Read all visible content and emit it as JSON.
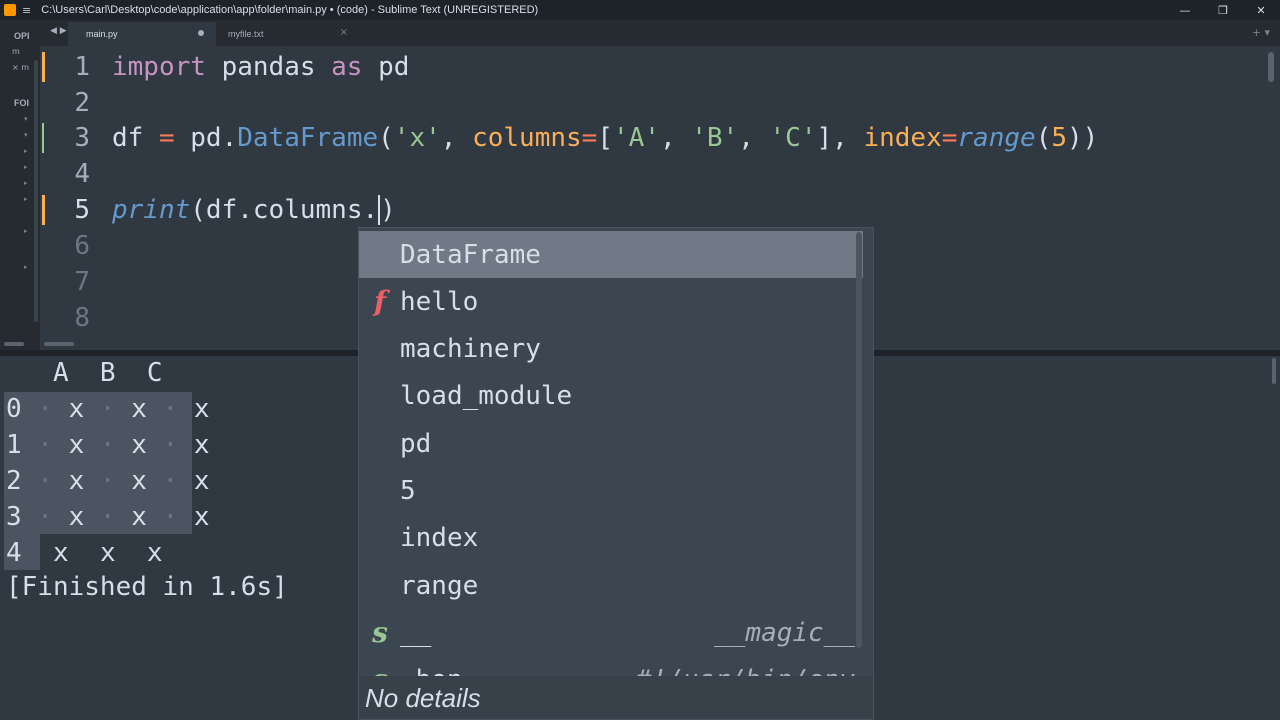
{
  "window": {
    "title": "C:\\Users\\Carl\\Desktop\\code\\application\\app\\folder\\main.py • (code) - Sublime Text (UNREGISTERED)",
    "minimize_glyph": "—",
    "maximize_glyph": "❐",
    "close_glyph": "✕",
    "menu_glyph": "≡"
  },
  "sidebar": {
    "open_files_label": "OPI",
    "folders_label": "FOI",
    "rows": [
      "m",
      "× m"
    ],
    "tree_glyphs": [
      "▾",
      "▾",
      "▸",
      "▸",
      "▸",
      "▸",
      "▸",
      "▸"
    ]
  },
  "tabs": {
    "nav": "◀ ▶",
    "items": [
      {
        "label": "main.py",
        "active": true,
        "dirty": true
      },
      {
        "label": "myfile.txt",
        "active": false,
        "close": "×"
      }
    ],
    "right_controls": "+ ▾"
  },
  "editor": {
    "lines": [
      {
        "number": "1",
        "modified": true
      },
      {
        "number": "2"
      },
      {
        "number": "3",
        "modified": true
      },
      {
        "number": "4"
      },
      {
        "number": "5",
        "modified": true,
        "current": true
      },
      {
        "number": "6"
      },
      {
        "number": "7"
      },
      {
        "number": "8"
      }
    ],
    "code": {
      "l1_import": "import",
      "l1_pandas": " pandas ",
      "l1_as": "as",
      "l1_pd": " pd",
      "l3_df": "df ",
      "l3_eq": "=",
      "l3_pd": " pd.",
      "l3_DataFrame": "DataFrame",
      "l3_open": "(",
      "l3_x": "'x'",
      "l3_comma1": ", ",
      "l3_columns": "columns",
      "l3_eq2": "=",
      "l3_bracket_open": "[",
      "l3_A": "'A'",
      "l3_comma2": ", ",
      "l3_B": "'B'",
      "l3_comma3": ", ",
      "l3_C": "'C'",
      "l3_bracket_close": "], ",
      "l3_index": "index",
      "l3_eq3": "=",
      "l3_range": "range",
      "l3_paren": "(",
      "l3_five": "5",
      "l3_close": "))",
      "l5_print": "print",
      "l5_rest": "(df.columns.",
      "l5_cursor_char": ")"
    }
  },
  "output": {
    "header": "   A  B  C",
    "rows": [
      {
        "index": "0",
        "cells": [
          "x",
          "x",
          "x"
        ]
      },
      {
        "index": "1",
        "cells": [
          "x",
          "x",
          "x"
        ]
      },
      {
        "index": "2",
        "cells": [
          "x",
          "x",
          "x"
        ]
      },
      {
        "index": "3",
        "cells": [
          "x",
          "x",
          "x"
        ]
      },
      {
        "index": "4",
        "cells": [
          "x",
          "x",
          "x"
        ]
      }
    ],
    "finished": "[Finished in 1.6s]"
  },
  "autocomplete": {
    "items": [
      {
        "kind": "",
        "label": "DataFrame",
        "annotation": "",
        "selected": true
      },
      {
        "kind": "f",
        "kind_color": "#ec5f67",
        "label": "hello",
        "annotation": ""
      },
      {
        "kind": "",
        "label": "machinery",
        "annotation": ""
      },
      {
        "kind": "",
        "label": "load_module",
        "annotation": ""
      },
      {
        "kind": "",
        "label": "pd",
        "annotation": ""
      },
      {
        "kind": "",
        "label": "5",
        "annotation": ""
      },
      {
        "kind": "",
        "label": "index",
        "annotation": ""
      },
      {
        "kind": "",
        "label": "range",
        "annotation": ""
      },
      {
        "kind": "s",
        "kind_color": "#99c794",
        "label": "__",
        "annotation": "__magic__"
      },
      {
        "kind": "s",
        "kind_color": "#99c794",
        "label": "_bon",
        "annotation": "#!/usr/bin/env"
      }
    ],
    "details": "No details"
  },
  "colors": {
    "background": "#303841",
    "keyword": "#c594c5",
    "operator": "#f97b58",
    "function": "#6699cc",
    "string": "#99c794",
    "parameter": "#f9ae58",
    "modified_marker": "#f9ae58"
  }
}
